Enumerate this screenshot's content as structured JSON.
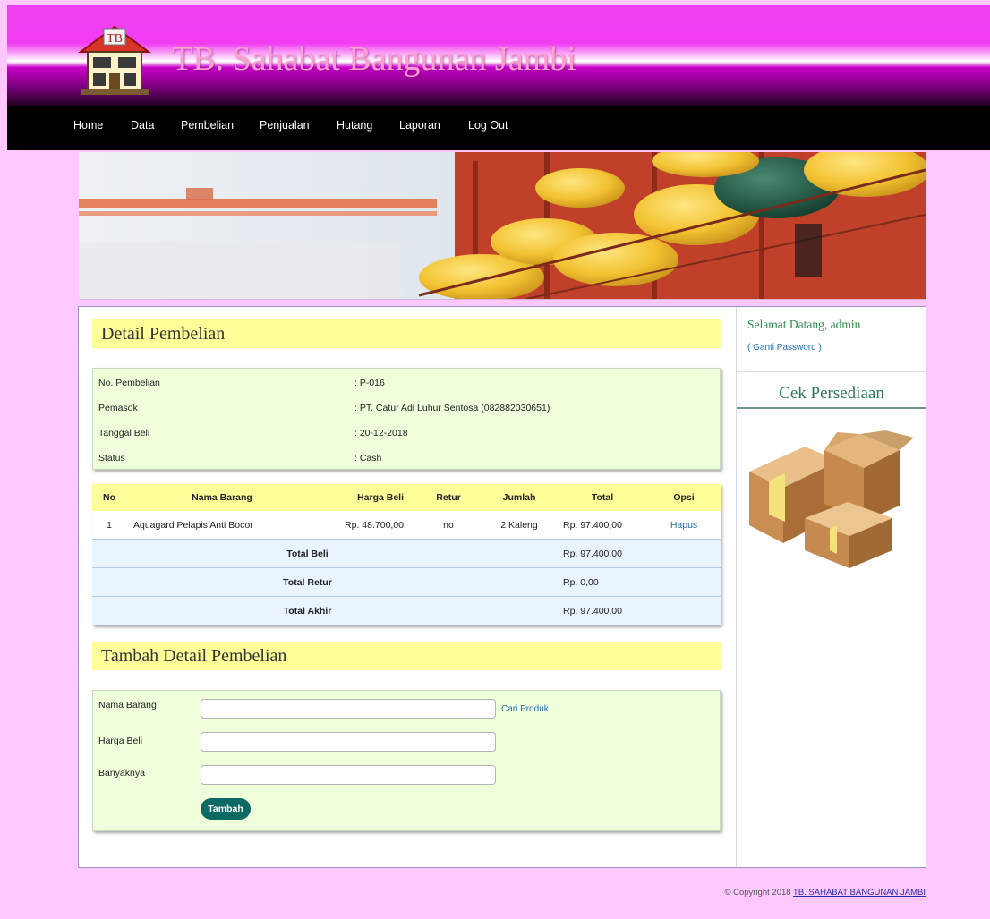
{
  "site": {
    "title": "TB. Sahabat Bangunan Jambi",
    "logo_text": "TB"
  },
  "nav": [
    {
      "label": "Home"
    },
    {
      "label": "Data"
    },
    {
      "label": "Pembelian"
    },
    {
      "label": "Penjualan"
    },
    {
      "label": "Hutang"
    },
    {
      "label": "Laporan"
    },
    {
      "label": "Log Out"
    }
  ],
  "detail": {
    "heading": "Detail Pembelian",
    "info": [
      {
        "label": "No. Pembelian",
        "value": ": P-016"
      },
      {
        "label": "Pemasok",
        "value": ": PT. Catur Adi Luhur Sentosa (082882030651)"
      },
      {
        "label": "Tanggal Beli",
        "value": ": 20-12-2018"
      },
      {
        "label": "Status",
        "value": ": Cash"
      }
    ],
    "table": {
      "headers": [
        "No",
        "Nama Barang",
        "Harga Beli",
        "Retur",
        "Jumlah",
        "Total",
        "Opsi"
      ],
      "rows": [
        {
          "no": "1",
          "nama": "Aquagard Pelapis Anti Bocor",
          "harga": "Rp. 48.700,00",
          "retur": "no",
          "jumlah": "2 Kaleng",
          "total": "Rp. 97.400,00",
          "opsi": "Hapus"
        }
      ],
      "summary": [
        {
          "label": "Total Beli",
          "value": "Rp. 97.400,00"
        },
        {
          "label": "Total Retur",
          "value": "Rp. 0,00"
        },
        {
          "label": "Total Akhir",
          "value": "Rp. 97.400,00"
        }
      ]
    }
  },
  "tambah": {
    "heading": "Tambah Detail Pembelian",
    "fields": {
      "nama_label": "Nama Barang",
      "nama_value": "",
      "harga_label": "Harga Beli",
      "harga_value": "",
      "banyak_label": "Banyaknya",
      "banyak_value": ""
    },
    "cari_link": "Cari Produk",
    "button_label": "Tambah"
  },
  "sidebar": {
    "welcome": "Selamat Datang, admin",
    "ganti_password": "( Ganti Password )",
    "cek_title": "Cek Persediaan"
  },
  "footer": {
    "copyright": "© Copyright 2018",
    "link": "TB. SAHABAT BANGUNAN JAMBI"
  },
  "colors": {
    "page_bg": "#ffc8ff",
    "header_magenta": "#f040f0",
    "heading_bg": "#ffff99",
    "panel_bg": "#efffdc",
    "button_bg": "#0b6a64",
    "link": "#1f6fb0"
  }
}
